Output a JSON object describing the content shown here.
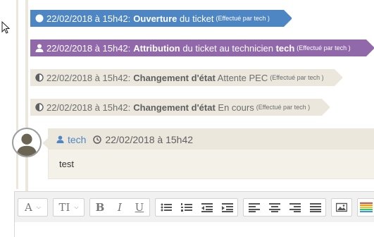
{
  "timeline": [
    {
      "date": "22/02/2018 à 15h42:",
      "action": "Ouverture",
      "rest": " du ticket",
      "by": "(Effectué par tech )",
      "icon": "circle-icon"
    },
    {
      "date": "22/02/2018 à 15h42:",
      "action": "Attribution",
      "mid": " du ticket au technicien ",
      "tech": "tech",
      "by": "(Effectué par tech )",
      "icon": "user-icon"
    },
    {
      "date": "22/02/2018 à 15h42:",
      "action": "Changement d'état",
      "rest": " Attente PEC",
      "by": "(Effectué par tech )",
      "icon": "half-circle-icon"
    },
    {
      "date": "22/02/2018 à 15h42:",
      "action": "Changement d'état",
      "rest": " En cours",
      "by": "(Effectué par tech )",
      "icon": "half-circle-icon"
    }
  ],
  "comment": {
    "author": "tech",
    "date": "22/02/2018 à 15h42",
    "text": "test"
  },
  "toolbar": {
    "font_label": "A",
    "size_label": "TI",
    "bold_label": "B",
    "italic_label": "I",
    "underline_label": "U"
  },
  "colors": {
    "blue": "#4e86c4",
    "purple": "#9169ab",
    "beige": "#ebe7dd"
  }
}
